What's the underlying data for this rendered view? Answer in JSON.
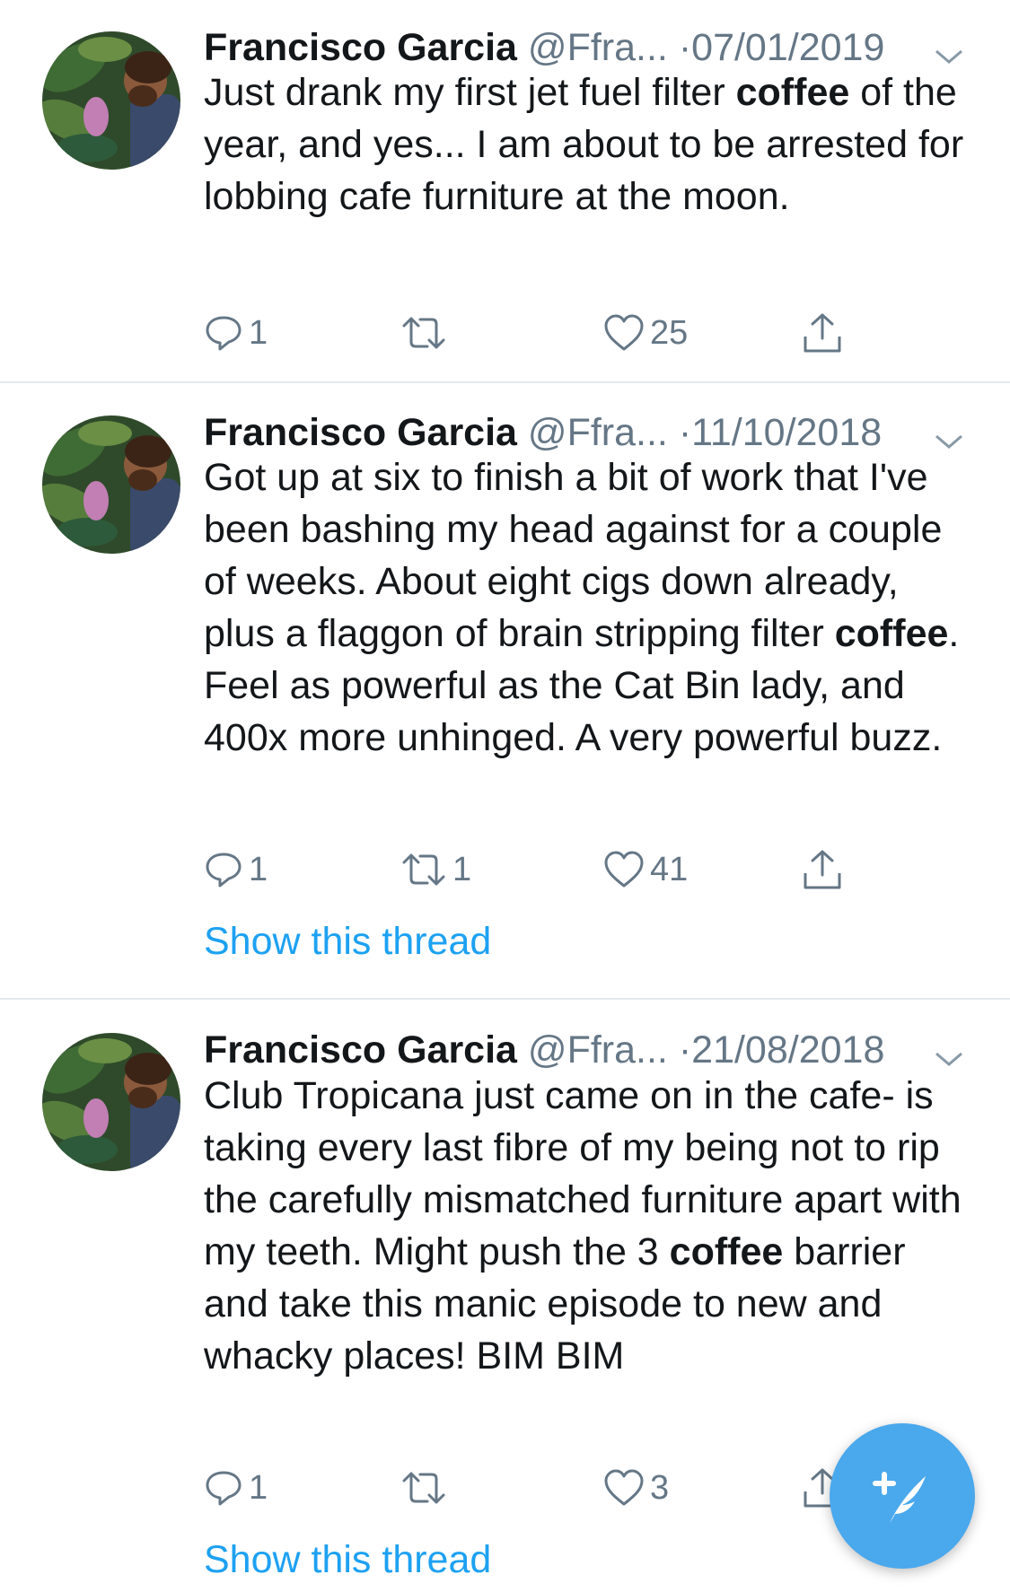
{
  "tweets": [
    {
      "author_name": "Francisco Garcia",
      "handle": "@Ffra...",
      "separator": "·",
      "date": "07/01/2019",
      "text_parts": [
        {
          "t": "Just drank my first jet fuel filter ",
          "bold": false
        },
        {
          "t": "coffee",
          "bold": true
        },
        {
          "t": " of the year, and yes... I am about to be arrested for lobbing cafe furniture at the moon.",
          "bold": false
        }
      ],
      "replies": "1",
      "retweets": "",
      "likes": "25",
      "show_thread": ""
    },
    {
      "author_name": "Francisco Garcia",
      "handle": "@Ffra...",
      "separator": "·",
      "date": "11/10/2018",
      "text_parts": [
        {
          "t": "Got up at six to finish a bit of work that I've been bashing my head against for a couple of weeks. About eight cigs down already, plus a flaggon of brain stripping filter ",
          "bold": false
        },
        {
          "t": "coffee",
          "bold": true
        },
        {
          "t": ". Feel as powerful as the Cat Bin lady, and 400x more unhinged. A very powerful buzz.",
          "bold": false
        }
      ],
      "replies": "1",
      "retweets": "1",
      "likes": "41",
      "show_thread": "Show this thread"
    },
    {
      "author_name": "Francisco Garcia",
      "handle": "@Ffra...",
      "separator": "·",
      "date": "21/08/2018",
      "text_parts": [
        {
          "t": "Club Tropicana just came on in the cafe- is taking every last fibre of my being not to rip the carefully mismatched furniture apart with my teeth. Might push the 3 ",
          "bold": false
        },
        {
          "t": "coffee",
          "bold": true
        },
        {
          "t": " barrier and take this manic episode to new and whacky places! BIM BIM",
          "bold": false
        }
      ],
      "replies": "1",
      "retweets": "",
      "likes": "3",
      "show_thread": "Show this thread"
    }
  ],
  "icons": {
    "reply": "reply-icon",
    "retweet": "retweet-icon",
    "like": "heart-icon",
    "share": "share-icon",
    "menu": "chevron-down-icon",
    "compose": "compose-tweet-icon"
  },
  "colors": {
    "link": "#1da1f2",
    "secondary": "#657786",
    "fab": "#4aa8ec",
    "divider": "#e1e8ed"
  }
}
